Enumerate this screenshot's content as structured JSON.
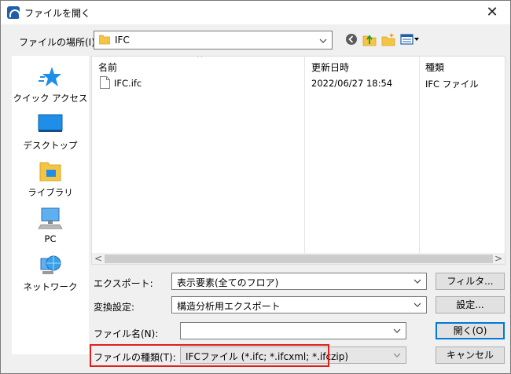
{
  "window": {
    "title": "ファイルを開く",
    "close_glyph": "✕"
  },
  "location": {
    "label": "ファイルの場所(I):",
    "value": "IFC"
  },
  "places": [
    {
      "label": "クイック アクセス",
      "icon": "star-icon"
    },
    {
      "label": "デスクトップ",
      "icon": "desktop-icon"
    },
    {
      "label": "ライブラリ",
      "icon": "library-icon"
    },
    {
      "label": "PC",
      "icon": "pc-icon"
    },
    {
      "label": "ネットワーク",
      "icon": "network-icon"
    }
  ],
  "filelist": {
    "columns": [
      "名前",
      "更新日時",
      "種類"
    ],
    "sort_glyph": "^",
    "rows": [
      {
        "name": "IFC.ifc",
        "modified": "2022/06/27 18:54",
        "type": "IFC ファイル"
      }
    ]
  },
  "scroll": {
    "left_glyph": "<",
    "right_glyph": ">"
  },
  "export": {
    "label": "エクスポート:",
    "value": "表示要素(全てのフロア)",
    "button": "フィルタ..."
  },
  "conversion": {
    "label": "変換設定:",
    "value": "構造分析用エクスポート",
    "button": "設定..."
  },
  "filename": {
    "label": "ファイル名(N):",
    "value": "",
    "button": "開く(O)"
  },
  "filetype": {
    "label": "ファイルの種類(T):",
    "value": "IFCファイル (*.ifc; *.ifcxml; *.ifczip)",
    "button": "キャンセル"
  },
  "colors": {
    "accent": "#0078d7",
    "highlight": "#e0201c",
    "folder": "#f4c545"
  }
}
